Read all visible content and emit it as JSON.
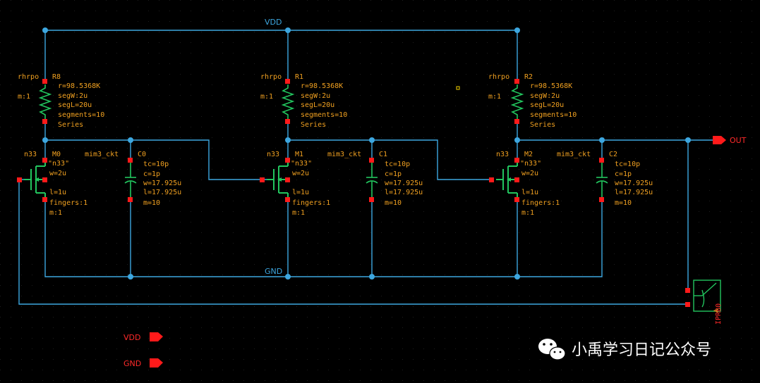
{
  "colors": {
    "background": "#000000",
    "wire": "#3da7e0",
    "pin": "#ff1a1a",
    "device": "#22c55e",
    "label": "#f0a020"
  },
  "nets": {
    "vdd": "VDD",
    "gnd": "GND",
    "out": "OUT"
  },
  "pins": {
    "vdd": "VDD",
    "gnd": "GND",
    "out": "OUT"
  },
  "resistors": [
    {
      "cell": "rhrpo",
      "inst": "R8",
      "m": "m:1",
      "r": "r=98.5368K",
      "segW": "segW:2u",
      "segL": "segL=20u",
      "segments": "segments=10",
      "mode": "Series"
    },
    {
      "cell": "rhrpo",
      "inst": "R1",
      "m": "m:1",
      "r": "r=98.5368K",
      "segW": "segW:2u",
      "segL": "segL=20u",
      "segments": "segments=10",
      "mode": "Series"
    },
    {
      "cell": "rhrpo",
      "inst": "R2",
      "m": "m:1",
      "r": "r=98.5368K",
      "segW": "segW:2u",
      "segL": "segL=20u",
      "segments": "segments=10",
      "mode": "Series"
    }
  ],
  "transistors": [
    {
      "cell": "n33",
      "inst": "M0",
      "model": "\"n33\"",
      "w": "w=2u",
      "l": "l=1u",
      "fingers": "fingers:1",
      "m": "m:1"
    },
    {
      "cell": "n33",
      "inst": "M1",
      "model": "\"n33\"",
      "w": "w=2u",
      "l": "l=1u",
      "fingers": "fingers:1",
      "m": "m:1"
    },
    {
      "cell": "n33",
      "inst": "M2",
      "model": "\"n33\"",
      "w": "w=2u",
      "l": "l=1u",
      "fingers": "fingers:1",
      "m": "m:1"
    }
  ],
  "capacitors": [
    {
      "cell": "mim3_ckt",
      "inst": "C0",
      "tc": "tc=10p",
      "c": "c=1p",
      "w": "w=17.925u",
      "l": "l=17.925u",
      "m": "m=10"
    },
    {
      "cell": "mim3_ckt",
      "inst": "C1",
      "tc": "tc=10p",
      "c": "c=1p",
      "w": "w=17.925u",
      "l": "l=17.925u",
      "m": "m=10"
    },
    {
      "cell": "mim3_ckt",
      "inst": "C2",
      "tc": "tc=10p",
      "c": "c=1p",
      "w": "w=17.925u",
      "l": "l=17.925u",
      "m": "m=10"
    }
  ],
  "probe": {
    "inst": "IPRB0",
    "pin": "A"
  },
  "watermark": "小禹学习日记公众号"
}
